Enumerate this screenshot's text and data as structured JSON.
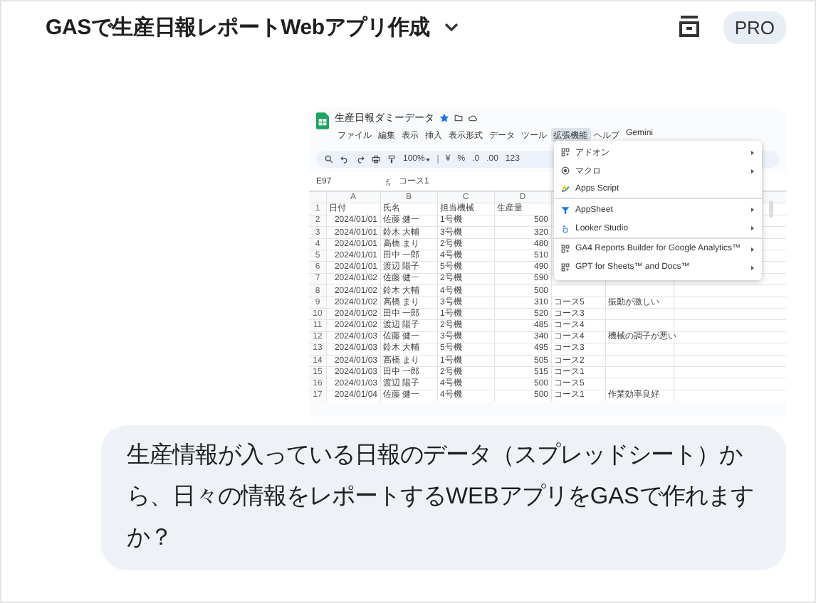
{
  "header": {
    "title": "GASで生産日報レポートWebアプリ作成",
    "badge": "PRO"
  },
  "attachment": {
    "kind": "screenshot",
    "doc_title": "生産日報ダミーデータ",
    "starred": true,
    "menus": [
      {
        "label": "ファイル",
        "selected": false
      },
      {
        "label": "編集",
        "selected": false
      },
      {
        "label": "表示",
        "selected": false
      },
      {
        "label": "挿入",
        "selected": false
      },
      {
        "label": "表示形式",
        "selected": false
      },
      {
        "label": "データ",
        "selected": false
      },
      {
        "label": "ツール",
        "selected": false
      },
      {
        "label": "拡張機能",
        "selected": true
      },
      {
        "label": "ヘルプ",
        "selected": false
      },
      {
        "label": "Gemini",
        "selected": false
      }
    ],
    "zoom": "100%",
    "format_buttons": [
      "¥",
      "%",
      ".0",
      ".00",
      "123"
    ],
    "cell_ref": "E97",
    "formula": "コース1",
    "columns": [
      "A",
      "B",
      "C",
      "D"
    ],
    "rows": [
      {
        "num": "1",
        "date": "日付",
        "name": "氏名",
        "machine": "担当機械",
        "amount": "生産量"
      },
      {
        "num": "2",
        "date": "2024/01/01",
        "name": "佐藤 健一",
        "machine": "1号機",
        "amount": "500"
      },
      {
        "num": "3",
        "date": "2024/01/01",
        "name": "鈴木 大輔",
        "machine": "3号機",
        "amount": "320"
      },
      {
        "num": "4",
        "date": "2024/01/01",
        "name": "高橋 まり",
        "machine": "2号機",
        "amount": "480"
      },
      {
        "num": "5",
        "date": "2024/01/01",
        "name": "田中 一郎",
        "machine": "4号機",
        "amount": "510"
      },
      {
        "num": "6",
        "date": "2024/01/01",
        "name": "渡辺 陽子",
        "machine": "5号機",
        "amount": "490"
      },
      {
        "num": "7",
        "date": "2024/01/02",
        "name": "佐藤 健一",
        "machine": "2号機",
        "amount": "590"
      },
      {
        "num": "8",
        "date": "2024/01/02",
        "name": "鈴木 大輔",
        "machine": "4号機",
        "amount": "500"
      },
      {
        "num": "9",
        "date": "2024/01/02",
        "name": "高橋 まり",
        "machine": "3号機",
        "amount": "310",
        "course": "コース5",
        "note": "振動が激しい"
      },
      {
        "num": "10",
        "date": "2024/01/02",
        "name": "田中 一郎",
        "machine": "1号機",
        "amount": "520",
        "course": "コース3"
      },
      {
        "num": "11",
        "date": "2024/01/02",
        "name": "渡辺 陽子",
        "machine": "2号機",
        "amount": "485",
        "course": "コース4"
      },
      {
        "num": "12",
        "date": "2024/01/03",
        "name": "佐藤 健一",
        "machine": "3号機",
        "amount": "340",
        "course": "コース4",
        "note": "機械の調子が悪い"
      },
      {
        "num": "13",
        "date": "2024/01/03",
        "name": "鈴木 大輔",
        "machine": "5号機",
        "amount": "495",
        "course": "コース3"
      },
      {
        "num": "14",
        "date": "2024/01/03",
        "name": "高橋 まり",
        "machine": "1号機",
        "amount": "505",
        "course": "コース2"
      },
      {
        "num": "15",
        "date": "2024/01/03",
        "name": "田中 一郎",
        "machine": "2号機",
        "amount": "515",
        "course": "コース1"
      },
      {
        "num": "16",
        "date": "2024/01/03",
        "name": "渡辺 陽子",
        "machine": "4号機",
        "amount": "500",
        "course": "コース5"
      },
      {
        "num": "17",
        "date": "2024/01/04",
        "name": "佐藤 健一",
        "machine": "4号機",
        "amount": "500",
        "course": "コース1",
        "note": "作業効率良好"
      }
    ],
    "dropdown": [
      {
        "label": "アドオン",
        "kind": "addon",
        "submenu": true
      },
      {
        "label": "マクロ",
        "kind": "macro",
        "submenu": true
      },
      {
        "label": "Apps Script",
        "kind": "script",
        "submenu": false,
        "divider_after": true
      },
      {
        "label": "AppSheet",
        "kind": "appsheet",
        "submenu": true
      },
      {
        "label": "Looker Studio",
        "kind": "looker",
        "submenu": true,
        "divider_after": true
      },
      {
        "label": "GA4 Reports Builder for Google Analytics™",
        "kind": "addon",
        "submenu": true
      },
      {
        "label": "GPT for Sheets™ and Docs™",
        "kind": "addon",
        "submenu": true
      }
    ]
  },
  "message": "生産情報が入っている日報のデータ（スプレッドシート）から、日々の情報をレポートするWEBアプリをGASで作れますか？"
}
